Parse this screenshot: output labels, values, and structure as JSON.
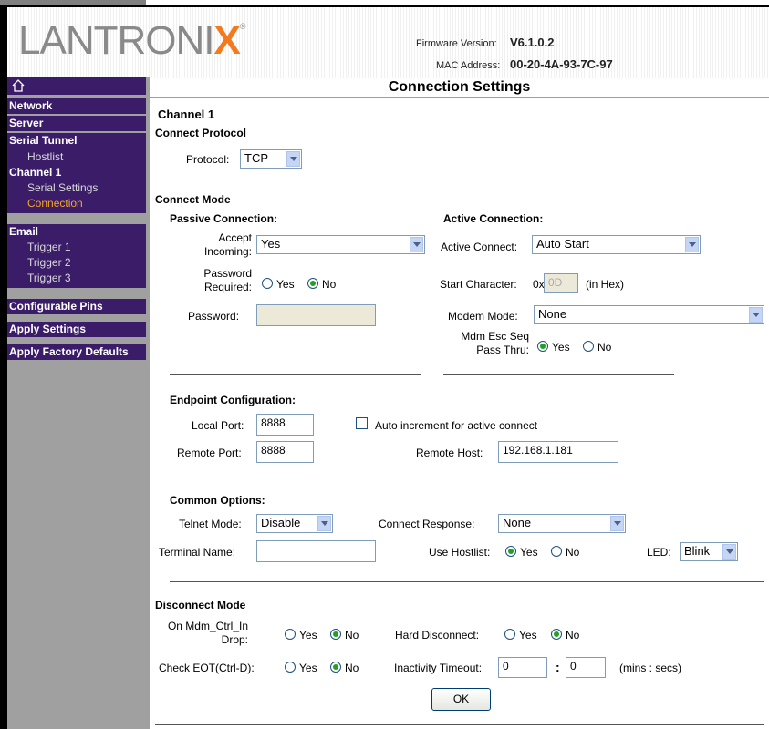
{
  "header": {
    "brand_main": "LANTRONI",
    "brand_x": "X",
    "brand_reg": "®",
    "firmware_label": "Firmware Version:",
    "firmware_value": "V6.1.0.2",
    "mac_label": "MAC Address:",
    "mac_value": "00-20-4A-93-7C-97"
  },
  "nav": {
    "home_icon": "home-icon",
    "network": "Network",
    "server": "Server",
    "serial_tunnel": "Serial Tunnel",
    "hostlist": "Hostlist",
    "channel1": "Channel 1",
    "serial_settings": "Serial Settings",
    "connection": "Connection",
    "email": "Email",
    "trigger1": "Trigger 1",
    "trigger2": "Trigger 2",
    "trigger3": "Trigger 3",
    "configurable_pins": "Configurable Pins",
    "apply_settings": "Apply Settings",
    "apply_factory_defaults": "Apply Factory Defaults"
  },
  "page": {
    "title": "Connection Settings",
    "channel": "Channel 1",
    "connect_protocol": "Connect Protocol",
    "protocol_label": "Protocol:",
    "protocol_value": "TCP",
    "connect_mode": "Connect Mode",
    "passive_title": "Passive Connection:",
    "accept_incoming_l1": "Accept",
    "accept_incoming_l2": "Incoming:",
    "accept_incoming_value": "Yes",
    "password_required_l1": "Password",
    "password_required_l2": "Required:",
    "yes": "Yes",
    "no": "No",
    "password_label": "Password:",
    "active_title": "Active Connection:",
    "active_connect_label": "Active Connect:",
    "active_connect_value": "Auto Start",
    "start_char_label": "Start Character:",
    "start_char_prefix": "0x",
    "start_char_value": "0D",
    "in_hex": "(in Hex)",
    "modem_mode_label": "Modem Mode:",
    "modem_mode_value": "None",
    "mdm_esc_l1": "Mdm Esc Seq",
    "mdm_esc_l2": "Pass Thru:",
    "endpoint_title": "Endpoint Configuration:",
    "local_port_label": "Local Port:",
    "local_port_value": "8888",
    "auto_increment_label": "Auto increment for active connect",
    "remote_port_label": "Remote Port:",
    "remote_port_value": "8888",
    "remote_host_label": "Remote Host:",
    "remote_host_value": "192.168.1.181",
    "common_title": "Common Options:",
    "telnet_mode_label": "Telnet Mode:",
    "telnet_mode_value": "Disable",
    "connect_response_label": "Connect Response:",
    "connect_response_value": "None",
    "terminal_name_label": "Terminal Name:",
    "terminal_name_value": "",
    "use_hostlist_label": "Use Hostlist:",
    "led_label": "LED:",
    "led_value": "Blink",
    "disconnect_mode": "Disconnect Mode",
    "mdm_ctrl_l1": "On Mdm_Ctrl_In",
    "mdm_ctrl_l2": "Drop:",
    "hard_disconnect_label": "Hard Disconnect:",
    "check_eot_label": "Check EOT(Ctrl-D):",
    "inactivity_label": "Inactivity Timeout:",
    "inactivity_min": "0",
    "colon": ":",
    "inactivity_sec": "0",
    "mins_secs": "(mins : secs)",
    "ok": "OK"
  },
  "colors": {
    "nav_bg": "#3a1c69",
    "accent": "#f47a20",
    "active_nav": "#f6a623"
  }
}
